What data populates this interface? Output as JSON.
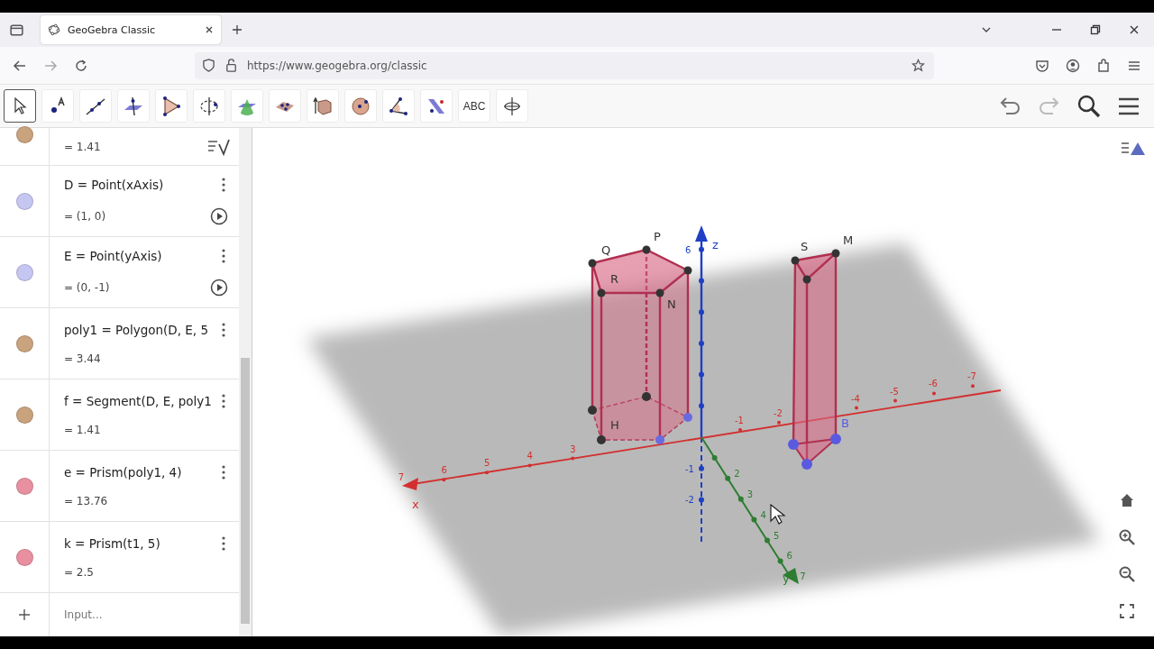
{
  "browser": {
    "tab": {
      "title": "GeoGebra Classic"
    },
    "url": "https://www.geogebra.org/classic"
  },
  "toolbar": {
    "tools": [
      {
        "kind": "move",
        "selected": true
      },
      {
        "kind": "point",
        "selected": false
      },
      {
        "kind": "line",
        "selected": false
      },
      {
        "kind": "perpendicular",
        "selected": false
      },
      {
        "kind": "polygon",
        "selected": false
      },
      {
        "kind": "rotate",
        "selected": false
      },
      {
        "kind": "intersect",
        "selected": false
      },
      {
        "kind": "plane-points",
        "selected": false
      },
      {
        "kind": "extrude",
        "selected": false
      },
      {
        "kind": "sphere",
        "selected": false
      },
      {
        "kind": "angle",
        "selected": false
      },
      {
        "kind": "reflect",
        "selected": false
      },
      {
        "kind": "text",
        "selected": false,
        "label": "ABC"
      },
      {
        "kind": "rotate-view",
        "selected": false
      }
    ]
  },
  "algebra": {
    "entries": [
      {
        "kind": "value-only",
        "color": "#c9a27e",
        "value": "= 1.41"
      },
      {
        "kind": "animatable",
        "color": "#c6c6f2",
        "definition": "D = Point(xAxis)",
        "value": "= (1, 0)"
      },
      {
        "kind": "animatable",
        "color": "#c6c6f2",
        "definition": "E = Point(yAxis)",
        "value": "= (0, -1)"
      },
      {
        "kind": "plain",
        "color": "#c9a27e",
        "definition": "poly1 = Polygon(D, E, 5",
        "value": "= 3.44"
      },
      {
        "kind": "plain",
        "color": "#c9a27e",
        "definition": "f = Segment(D, E, poly1",
        "value": "= 1.41"
      },
      {
        "kind": "plain",
        "color": "#e8909f",
        "definition": "e = Prism(poly1, 4)",
        "value": "= 13.76"
      },
      {
        "kind": "plain",
        "color": "#e8909f",
        "definition": "k = Prism(t1, 5)",
        "value": "= 2.5"
      }
    ],
    "input_placeholder": "Input..."
  },
  "graphics": {
    "axis_labels": [
      "x",
      "y",
      "z"
    ],
    "x_ticks": [
      "7",
      "6",
      "5",
      "4",
      "3"
    ],
    "x_negative_ticks": [
      "-1",
      "-2",
      "-4",
      "-5",
      "-6",
      "-7"
    ],
    "y_ticks": [
      "2",
      "3",
      "4",
      "5",
      "6",
      "7"
    ],
    "z_ticks": [
      "6",
      "-1",
      "-2"
    ],
    "point_labels": [
      "Q",
      "P",
      "R",
      "N",
      "H",
      "S",
      "M",
      "B"
    ]
  }
}
